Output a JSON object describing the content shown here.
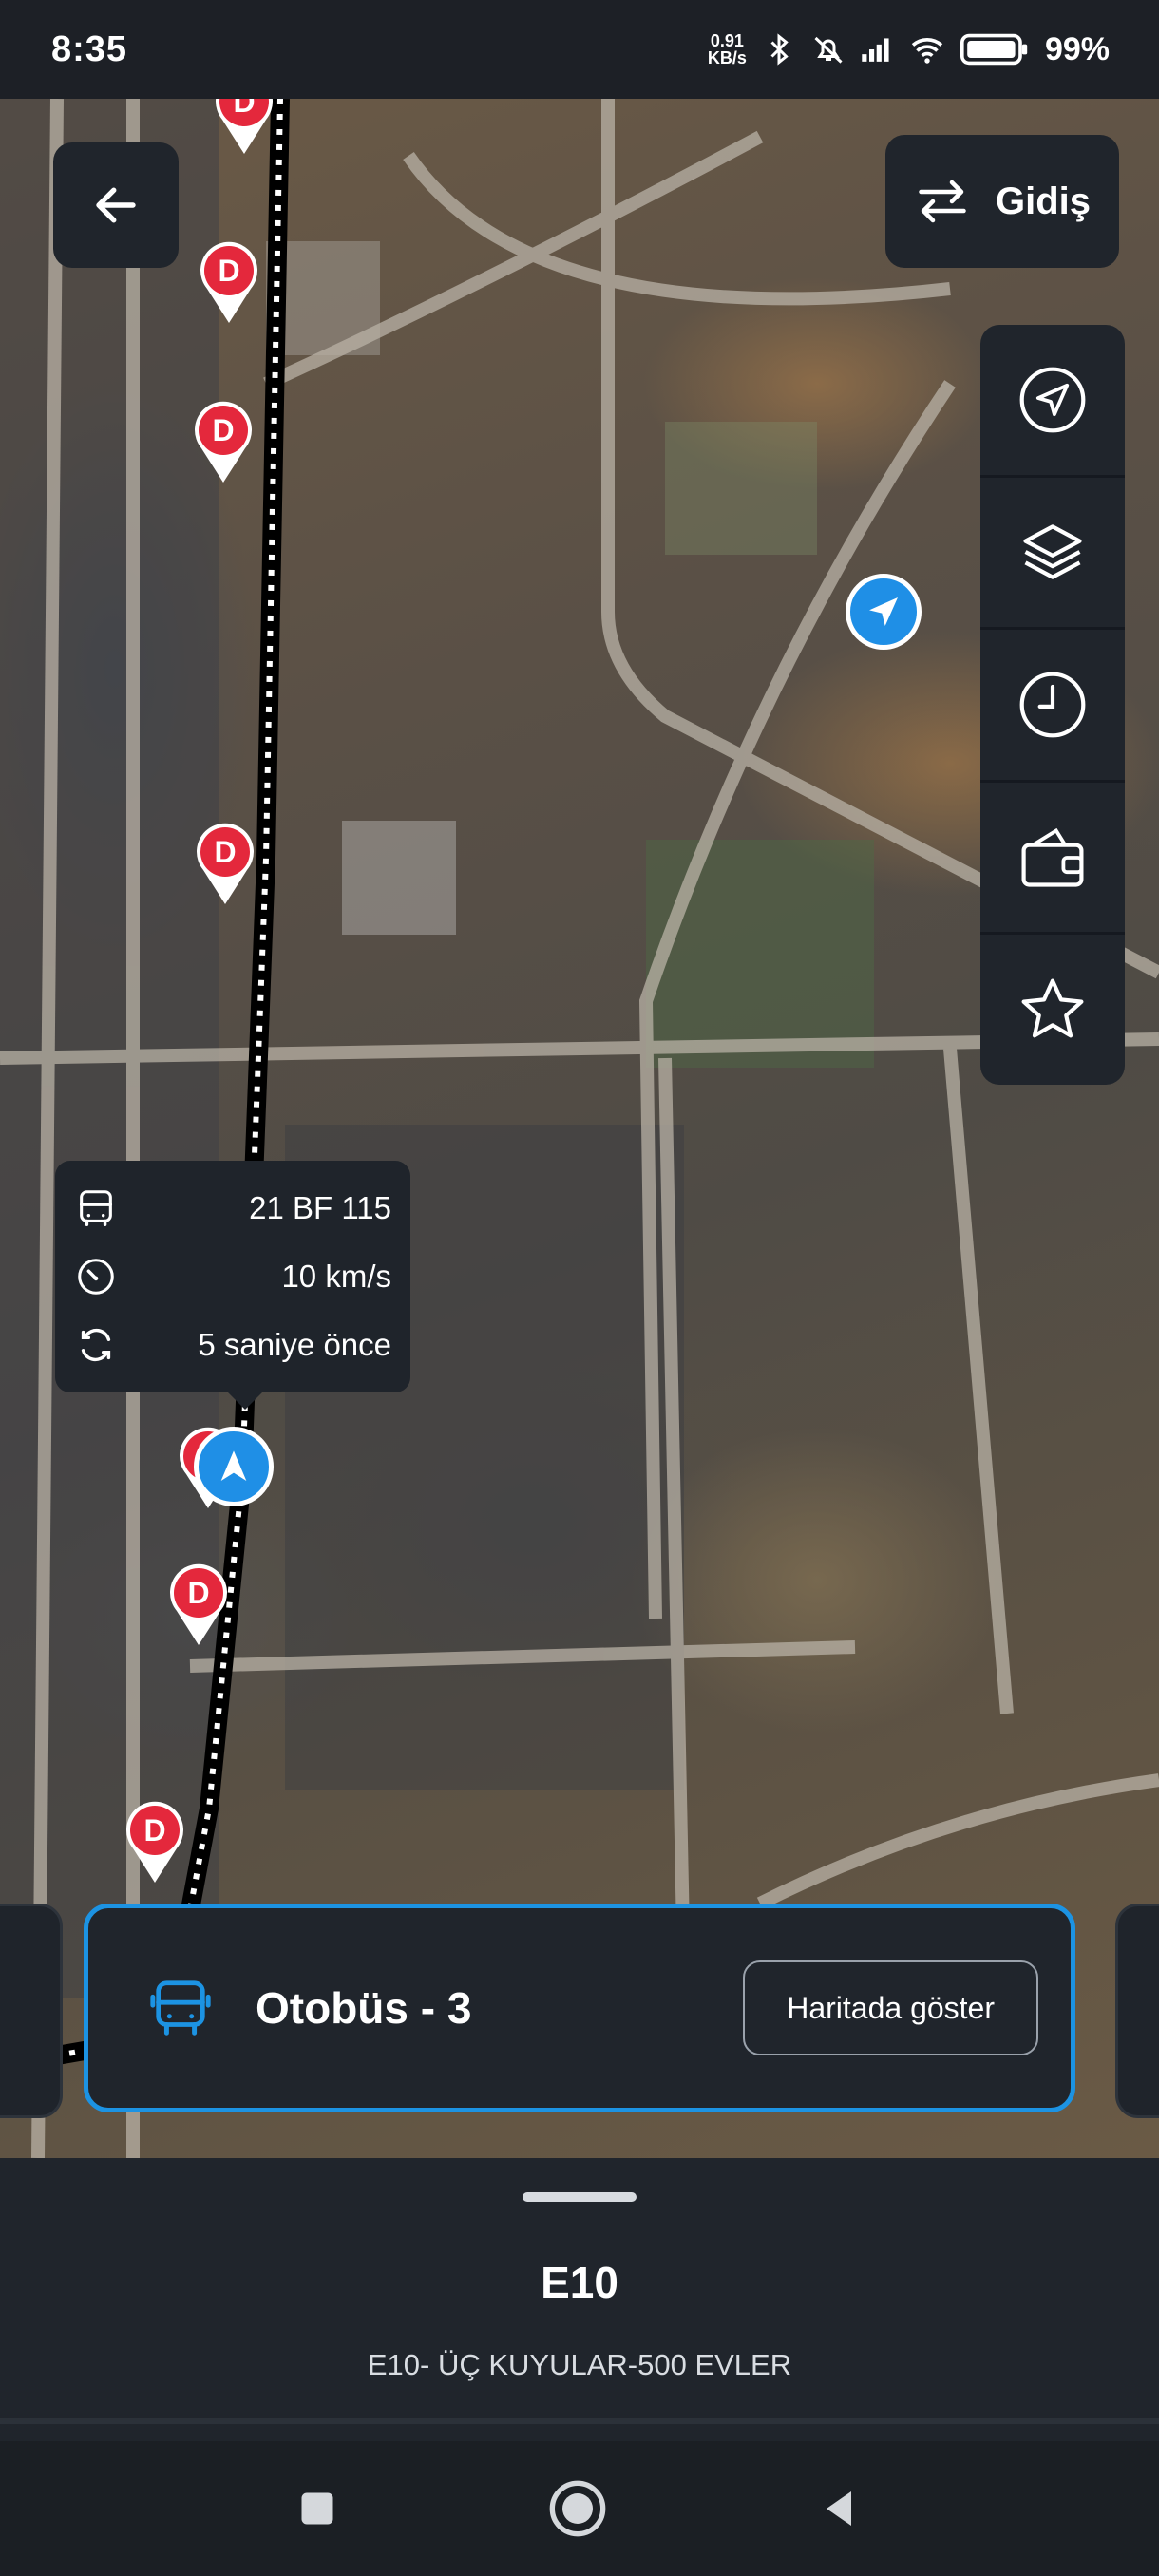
{
  "status_bar": {
    "time": "8:35",
    "net_speed_value": "0.91",
    "net_speed_unit": "KB/s",
    "battery": "99%",
    "icons": [
      "bluetooth-icon",
      "mute-icon",
      "signal-icon",
      "wifi-icon",
      "battery-icon"
    ]
  },
  "map": {
    "back_icon": "arrow-left-icon",
    "direction_toggle": {
      "label": "Gidiş",
      "icon": "swap-arrows-icon"
    },
    "tools": [
      "navigate-icon",
      "layers-icon",
      "clock-icon",
      "wallet-icon",
      "star-icon"
    ],
    "stop_pin_label": "D",
    "stop_pin_color": "#e4283c",
    "route_color": "#000000",
    "vehicle_popup": {
      "plate": "21 BF 115",
      "speed": "10 km/s",
      "updated": "5 saniye önce"
    }
  },
  "vehicle_card": {
    "title": "Otobüs - 3",
    "button_label": "Haritada göster",
    "accent": "#1c93e3"
  },
  "bottom_sheet": {
    "route_code": "E10",
    "route_name": "E10- ÜÇ KUYULAR-500 EVLER"
  },
  "nav_bar": {
    "icons": [
      "recents-square-icon",
      "home-circle-icon",
      "back-triangle-icon"
    ]
  }
}
